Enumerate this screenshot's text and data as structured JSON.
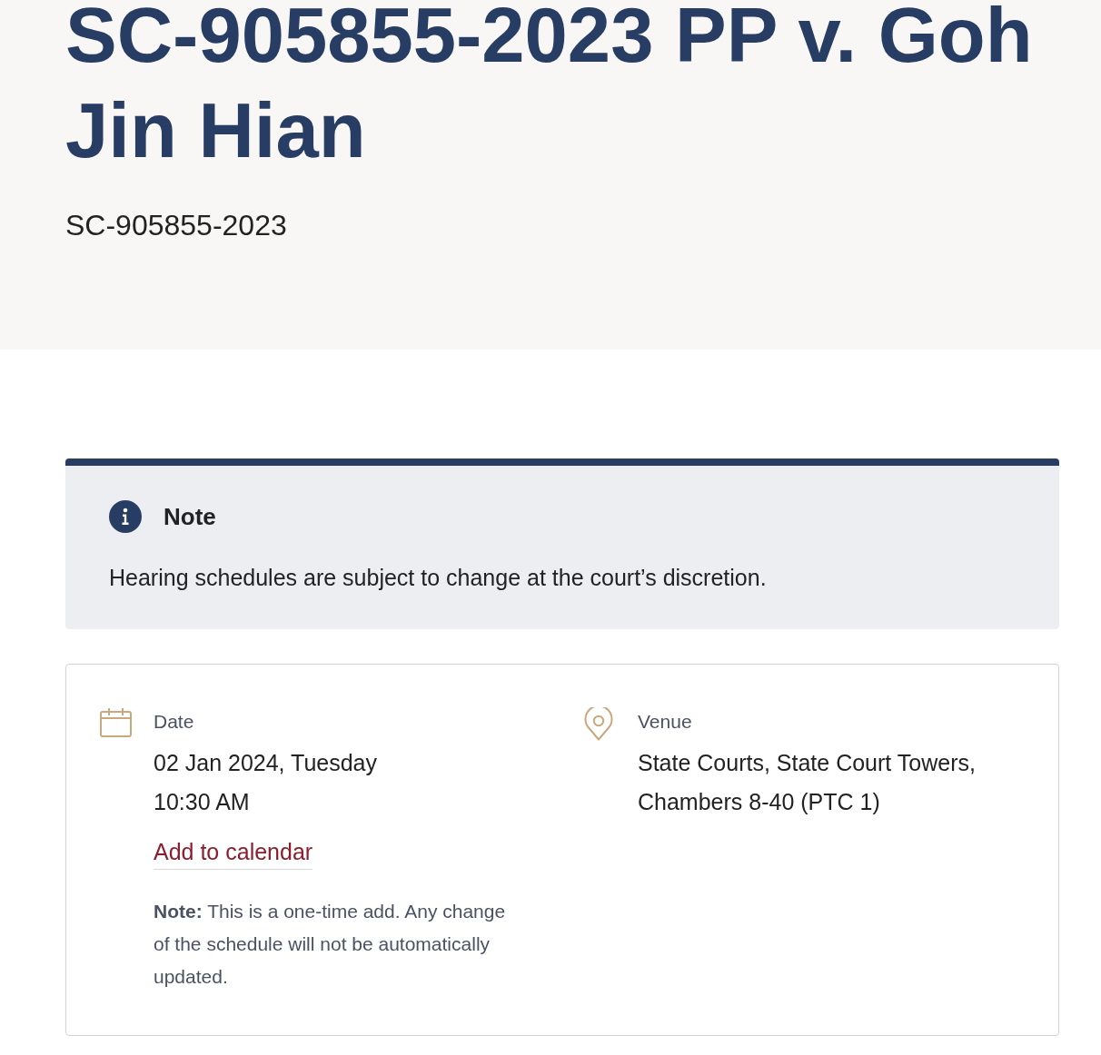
{
  "header": {
    "title": "SC-905855-2023 PP v. Goh Jin Hian",
    "case_number": "SC-905855-2023"
  },
  "notice": {
    "title": "Note",
    "message": "Hearing schedules are subject to change at the court’s discretion."
  },
  "details": [
    {
      "kind": "date",
      "label": "Date",
      "lines": [
        "02 Jan 2024, Tuesday",
        "10:30 AM"
      ],
      "link": "Add to calendar",
      "note": "**Note:** This is a one-time add. Any change of the schedule will not be automatically updated."
    },
    {
      "kind": "venue",
      "label": "Venue",
      "lines": [
        "State Courts, State Court Towers, Chambers 8-40 (PTC 1)"
      ]
    }
  ]
}
